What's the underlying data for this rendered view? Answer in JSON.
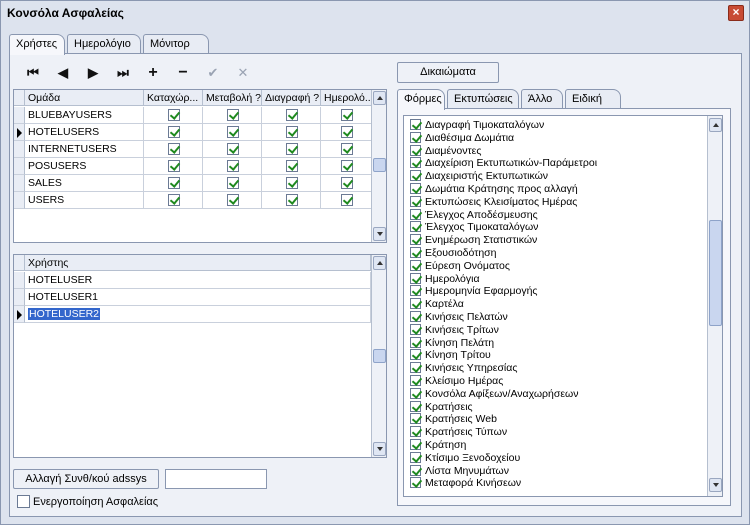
{
  "window": {
    "title": "Κονσόλα Ασφαλείας",
    "close_label": "×"
  },
  "main_tabs": [
    "Χρήστες",
    "Ημερολόγιο",
    "Μόνιτορ"
  ],
  "toolbar": {
    "first": "⏮",
    "prev": "◀",
    "next": "▶",
    "last": "⏭",
    "add": "+",
    "delete": "−",
    "post": "✔",
    "cancel": "✕"
  },
  "groups_grid": {
    "columns": [
      "Ομάδα",
      "Καταχώρ...",
      "Μεταβολή ?",
      "Διαγραφή ?",
      "Ημερολό..."
    ],
    "rows": [
      {
        "name": "BLUEBAYUSERS",
        "insert": true,
        "edit": true,
        "delete": true,
        "log": true
      },
      {
        "name": "HOTELUSERS",
        "insert": true,
        "edit": true,
        "delete": true,
        "log": true
      },
      {
        "name": "INTERNETUSERS",
        "insert": true,
        "edit": true,
        "delete": true,
        "log": true
      },
      {
        "name": "POSUSERS",
        "insert": true,
        "edit": true,
        "delete": true,
        "log": true
      },
      {
        "name": "SALES",
        "insert": true,
        "edit": true,
        "delete": true,
        "log": true
      },
      {
        "name": "USERS",
        "insert": true,
        "edit": true,
        "delete": true,
        "log": true
      }
    ]
  },
  "users_grid": {
    "column": "Χρήστης",
    "rows": [
      "HOTELUSER",
      "HOTELUSER1",
      "HOTELUSER2"
    ]
  },
  "change_password_button": "Αλλαγή Συνθ/κού adssys",
  "password_value": "",
  "enable_security_label": "Ενεργοποίηση Ασφαλείας",
  "rights_button": "Δικαιώματα",
  "rights_tabs": [
    "Φόρμες",
    "Εκτυπώσεις",
    "Άλλο",
    "Ειδική"
  ],
  "forms": [
    "Διαγραφή Τιμοκαταλόγων",
    "Διαθέσιμα Δωμάτια",
    "Διαμένοντες",
    "Διαχείριση Εκτυπωτικών-Παράμετροι",
    "Διαχειριστής Εκτυπωτικών",
    "Δωμάτια Κράτησης προς αλλαγή",
    "Εκτυπώσεις Κλεισίματος Ημέρας",
    "Έλεγχος Αποδέσμευσης",
    "Έλεγχος Τιμοκαταλόγων",
    "Ενημέρωση Στατιστικών",
    "Εξουσιοδότηση",
    "Εύρεση Ονόματος",
    "Ημερολόγια",
    "Ημερομηνία Εφαρμογής",
    "Καρτέλα",
    "Κινήσεις Πελατών",
    "Κινήσεις Τρίτων",
    "Κίνηση Πελάτη",
    "Κίνηση Τρίτου",
    "Κινήσεις Υπηρεσίας",
    "Κλείσιμο Ημέρας",
    "Κονσόλα Αφίξεων/Αναχωρήσεων",
    "Κρατήσεις",
    "Κρατήσεις Web",
    "Κρατήσεις Τύπων",
    "Κράτηση",
    "Κτίσιμο Ξενοδοχείου",
    "Λίστα Μηνυμάτων",
    "Μεταφορά Κινήσεων"
  ]
}
